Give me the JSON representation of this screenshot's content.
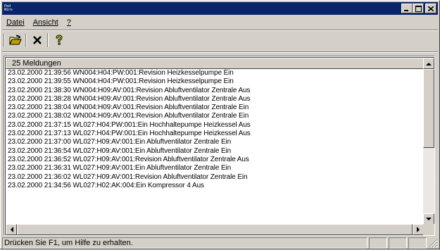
{
  "window": {
    "icon_text_top": "Ped",
    "icon_text_bottom": "Wins"
  },
  "menu": {
    "items": [
      {
        "label": "Datei"
      },
      {
        "label": "Ansicht"
      },
      {
        "label": "?"
      }
    ]
  },
  "toolbar": {
    "buttons": [
      "open-folder-icon",
      "delete-x-icon",
      "help-question-icon"
    ]
  },
  "list": {
    "header": "25 Meldungen",
    "rows": [
      "23.02.2000 21:39:56 WN004:H04:PW:001:Revision Heizkesselpumpe Ein",
      "23.02.2000 21:39:55 WN004:H04:PW:001:Revision Heizkesselpumpe Ein",
      "23.02.2000 21:38:30 WN004:H09:AV:001:Revision Abluftventilator Zentrale Aus",
      "23.02.2000 21:38:28 WN004:H09:AV:001:Revision Abluftventilator Zentrale Aus",
      "23.02.2000 21:38:04 WN004:H09:AV:001:Revision Abluftventilator Zentrale Ein",
      "23.02.2000 21:38:02 WN004:H09:AV:001:Revision Abluftventilator Zentrale Ein",
      "23.02.2000 21:37:15 WL027:H04:PW:001:Ein Hochhaltepumpe Heizkessel Aus",
      "23.02.2000 21:37:13 WL027:H04:PW:001:Ein Hochhaltepumpe Heizkessel Aus",
      "23.02.2000 21:37:00 WL027:H09:AV:001:Ein Abluftventilator Zentrale Ein",
      "23.02.2000 21:36:54 WL027:H09:AV:001:Ein Abluftventilator Zentrale Ein",
      "23.02.2000 21:36:52 WL027:H09:AV:001:Revision Abluftventilator Zentrale Aus",
      "23.02.2000 21:36:31 WL027:H09:AV:001:Ein Abluftventilator Zentrale Ein",
      "23.02.2000 21:36:02 WL027:H09:AV:001:Revision Abluftventilator Zentrale Ein",
      "23.02.2000 21:34:56 WL027:H02:AK:004:Ein Kompressor 4 Aus"
    ]
  },
  "status": {
    "text": "Drücken Sie F1, um Hilfe zu erhalten."
  },
  "colors": {
    "titlebar": "#0a246a",
    "face": "#d4d0c8"
  }
}
